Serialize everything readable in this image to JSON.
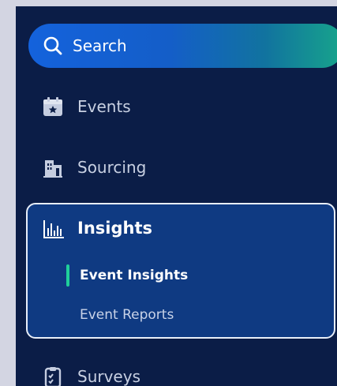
{
  "search": {
    "label": "Search",
    "icon": "search-icon"
  },
  "nav": {
    "events": {
      "label": "Events",
      "icon": "calendar-icon"
    },
    "sourcing": {
      "label": "Sourcing",
      "icon": "building-icon"
    },
    "insights": {
      "label": "Insights",
      "icon": "bar-chart-icon",
      "expanded": true,
      "children": [
        {
          "label": "Event Insights",
          "active": true
        },
        {
          "label": "Event Reports",
          "active": false
        }
      ]
    },
    "surveys": {
      "label": "Surveys",
      "icon": "clipboard-icon"
    }
  },
  "colors": {
    "sidebar_bg": "#0b1d47",
    "panel_bg": "#0f3a82",
    "accent": "#1fcf9a",
    "search_gradient_start": "#1462dc",
    "search_gradient_end": "#17a58b"
  }
}
